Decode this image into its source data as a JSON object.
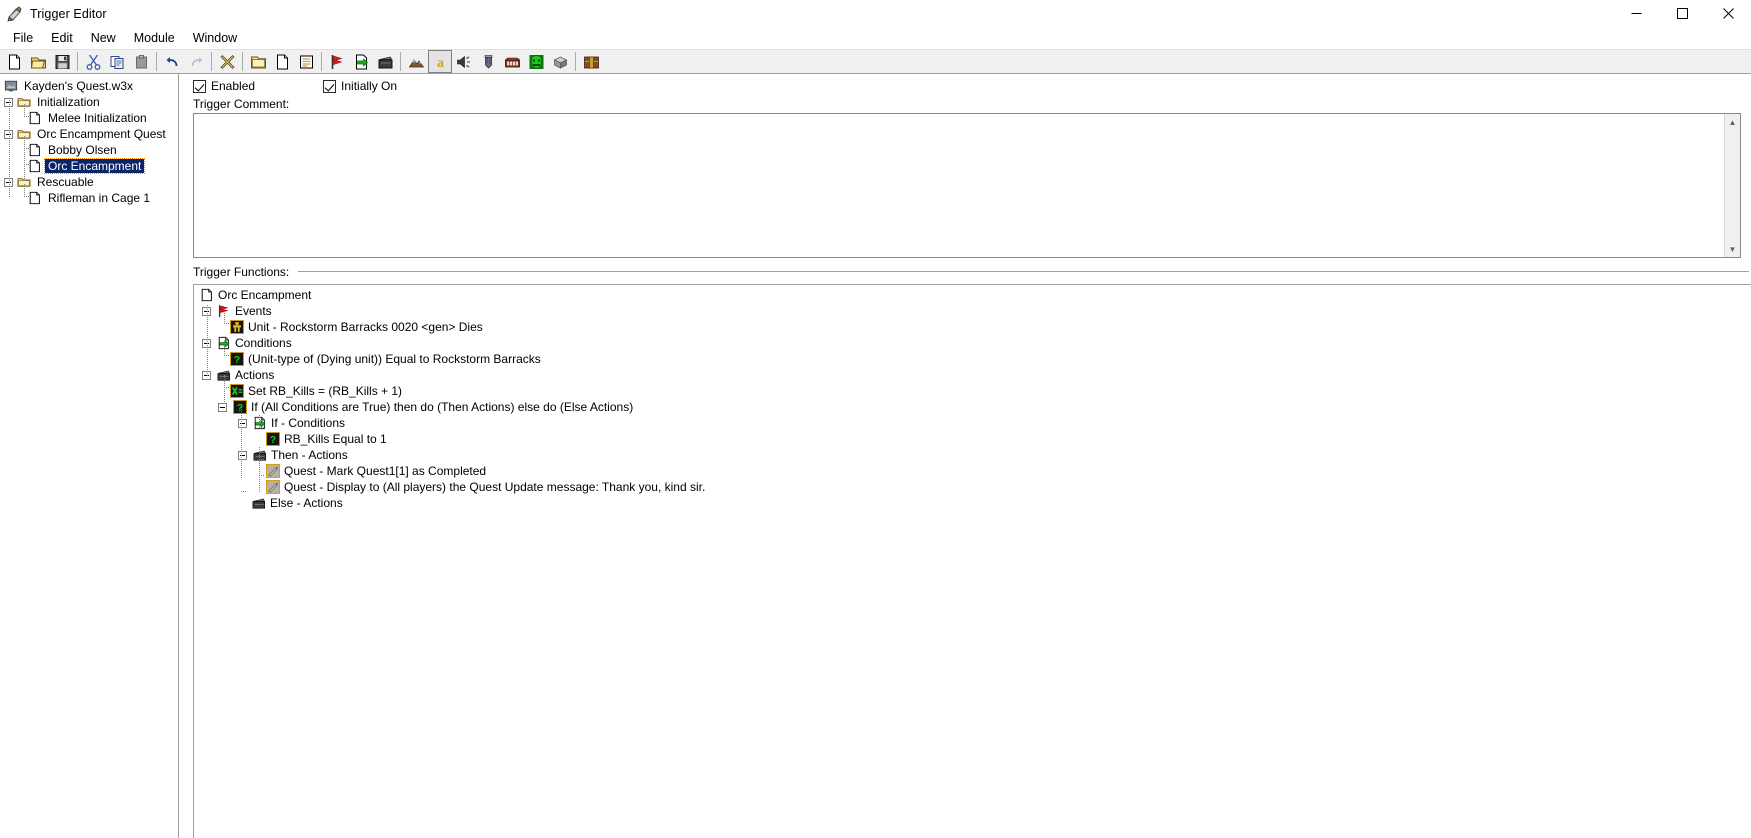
{
  "window": {
    "title": "Trigger Editor",
    "icon": "trigger-editor-icon",
    "minimize": "—",
    "maximize": "❐",
    "close": "✕"
  },
  "menubar": {
    "items": [
      {
        "label": "File"
      },
      {
        "label": "Edit"
      },
      {
        "label": "New"
      },
      {
        "label": "Module"
      },
      {
        "label": "Window"
      }
    ]
  },
  "toolbar": {
    "buttons": [
      {
        "name": "new-map-icon",
        "tip": "New Map"
      },
      {
        "name": "open-map-icon",
        "tip": "Open Map"
      },
      {
        "name": "save-map-icon",
        "tip": "Save Map"
      },
      {
        "name": "cut-icon",
        "tip": "Cut"
      },
      {
        "name": "copy-icon",
        "tip": "Copy"
      },
      {
        "name": "paste-icon",
        "tip": "Paste"
      },
      {
        "name": "undo-icon",
        "tip": "Undo"
      },
      {
        "name": "redo-icon",
        "tip": "Redo"
      },
      {
        "name": "delete-x-icon",
        "tip": "Delete"
      },
      {
        "name": "new-category-icon",
        "tip": "New Trigger Category"
      },
      {
        "name": "new-trigger-icon",
        "tip": "New Trigger"
      },
      {
        "name": "new-comment-icon",
        "tip": "New Trigger Comment"
      },
      {
        "name": "new-event-icon",
        "tip": "New Event"
      },
      {
        "name": "new-condition-icon",
        "tip": "New Condition"
      },
      {
        "name": "new-action-icon",
        "tip": "New Action"
      },
      {
        "name": "terrain-editor-icon",
        "tip": "Terrain Editor"
      },
      {
        "name": "trigger-editor-icon",
        "tip": "Trigger Editor"
      },
      {
        "name": "sound-editor-icon",
        "tip": "Sound Editor"
      },
      {
        "name": "object-editor-icon",
        "tip": "Object Editor"
      },
      {
        "name": "campaign-editor-icon",
        "tip": "Campaign Editor"
      },
      {
        "name": "ai-editor-icon",
        "tip": "AI Editor"
      },
      {
        "name": "object-manager-icon",
        "tip": "Object Manager"
      },
      {
        "name": "import-manager-icon",
        "tip": "Import Manager"
      }
    ]
  },
  "tree": {
    "root": {
      "label": "Kayden's Quest.w3x",
      "icon": "map-icon"
    },
    "nodes": [
      {
        "label": "Initialization",
        "icon": "folder-icon",
        "depth": 1,
        "expanded": true
      },
      {
        "label": "Melee Initialization",
        "icon": "trigger-icon",
        "depth": 2
      },
      {
        "label": "Orc Encampment Quest",
        "icon": "folder-icon",
        "depth": 1,
        "expanded": true
      },
      {
        "label": "Bobby Olsen",
        "icon": "trigger-icon",
        "depth": 2
      },
      {
        "label": "Orc Encampment",
        "icon": "trigger-icon",
        "depth": 2,
        "selected": true
      },
      {
        "label": "Rescuable",
        "icon": "folder-icon",
        "depth": 1,
        "expanded": true
      },
      {
        "label": "Rifleman in Cage 1",
        "icon": "trigger-icon",
        "depth": 2
      }
    ]
  },
  "editor": {
    "enabled_label": "Enabled",
    "enabled_checked": true,
    "initially_on_label": "Initially On",
    "initially_on_checked": true,
    "comment_label": "Trigger Comment:",
    "comment_value": "",
    "functions_label": "Trigger Functions:"
  },
  "functions_tree": [
    {
      "label": "Orc Encampment",
      "icon": "trigger-icon",
      "depth": 0
    },
    {
      "label": "Events",
      "icon": "event-flag-icon",
      "depth": 1,
      "expanded": true
    },
    {
      "label": "Unit - Rockstorm Barracks 0020 <gen> Dies",
      "icon": "event-item-icon",
      "depth": 2
    },
    {
      "label": "Conditions",
      "icon": "condition-icon",
      "depth": 1,
      "expanded": true
    },
    {
      "label": "(Unit-type of (Dying unit)) Equal to Rockstorm Barracks",
      "icon": "question-icon",
      "depth": 2
    },
    {
      "label": "Actions",
      "icon": "action-icon",
      "depth": 1,
      "expanded": true
    },
    {
      "label": "Set RB_Kills = (RB_Kills + 1)",
      "icon": "set-variable-icon",
      "depth": 2
    },
    {
      "label": "If (All Conditions are True) then do (Then Actions) else do (Else Actions)",
      "icon": "question-icon",
      "depth": 2,
      "expanded": true
    },
    {
      "label": "If - Conditions",
      "icon": "condition-icon",
      "depth": 3,
      "expanded": true
    },
    {
      "label": "RB_Kills Equal to 1",
      "icon": "question-icon",
      "depth": 4
    },
    {
      "label": "Then - Actions",
      "icon": "action-icon",
      "depth": 3,
      "expanded": true
    },
    {
      "label": "Quest - Mark Quest1[1] as Completed",
      "icon": "quest-icon",
      "depth": 4
    },
    {
      "label": "Quest - Display to (All players) the Quest Update message: Thank you, kind sir.",
      "icon": "quest-icon",
      "depth": 4
    },
    {
      "label": "Else - Actions",
      "icon": "action-icon",
      "depth": 3
    }
  ],
  "colors": {
    "selection_blue": "#0a246a",
    "toolbar_bg": "#f0f0f0",
    "border_gray": "#a0a0a0",
    "folder_yellow": "#f5d77a",
    "event_red": "#e01010",
    "condition_green": "#00b000",
    "quest_gold": "#c0a030"
  }
}
